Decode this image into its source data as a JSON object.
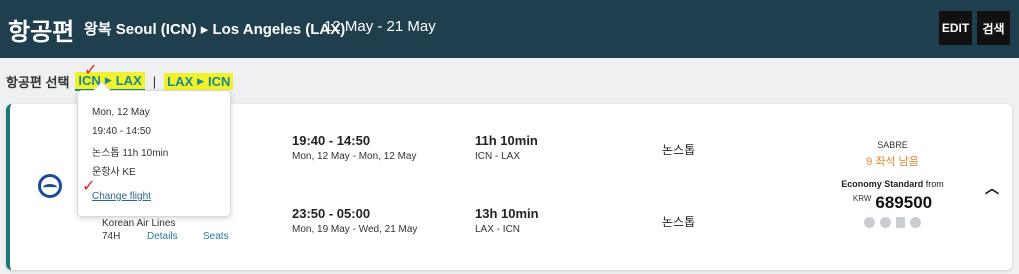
{
  "header": {
    "title": "항공편",
    "route": "왕복 Seoul (ICN) ▸ Los Angeles (LAX)",
    "dates": "12 May - 21 May",
    "edit_label": "EDIT",
    "search_label": "검색"
  },
  "selector": {
    "label": "항공편 선택",
    "segments": [
      {
        "from": "ICN",
        "to": "LAX"
      },
      {
        "from": "LAX",
        "to": "ICN"
      }
    ],
    "separator": "|"
  },
  "popover": {
    "date": "Mon, 12 May",
    "time": "19:40 - 14:50",
    "stops": "논스톱 11h 10min",
    "operator": "운항사 KE",
    "change_link": "Change flight"
  },
  "flight": {
    "airline": "Korean Air Lines",
    "flight_number": "74H",
    "details_link": "Details",
    "seats_link": "Seats",
    "legs": [
      {
        "times": "19:40 - 14:50",
        "dates": "Mon, 12 May - Mon, 12 May",
        "duration": "11h 10min",
        "route": "ICN - LAX",
        "stops": "논스톱"
      },
      {
        "times": "23:50 - 05:00",
        "dates": "Mon, 19 May - Wed, 21 May",
        "duration": "13h 10min",
        "route": "LAX - ICN",
        "stops": "논스톱"
      }
    ]
  },
  "fare": {
    "source": "SABRE",
    "seats_left": "9 좌석 남음",
    "cabin": "Economy Standard",
    "cabin_suffix": "from",
    "currency": "KRW",
    "amount": "689500"
  },
  "colors": {
    "header_bg": "#1f3f4f",
    "accent": "#1a8a8a",
    "highlight": "#f2f22c",
    "seats_left": "#d9892b"
  }
}
